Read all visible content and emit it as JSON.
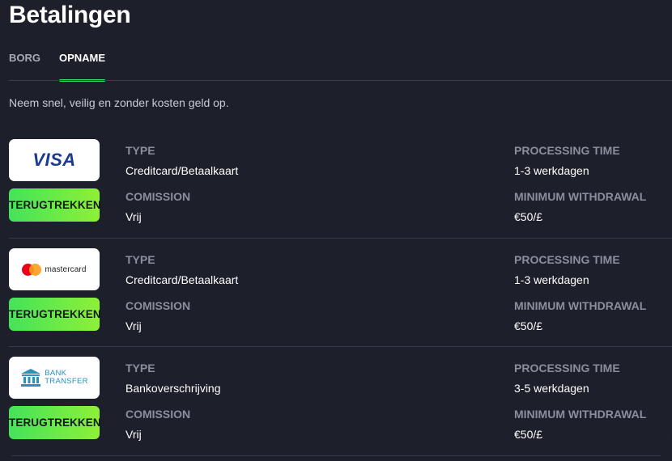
{
  "page": {
    "title": "Betalingen",
    "subtitle": "Neem snel, veilig en zonder kosten geld op."
  },
  "tabs": [
    {
      "label": "BORG",
      "active": false
    },
    {
      "label": "OPNAME",
      "active": true
    }
  ],
  "colors": {
    "background": "#1d1f2b",
    "accent": "#2ee36b",
    "button_start": "#43e35a",
    "button_end": "#8ef037",
    "label": "#8b8e9b"
  },
  "labels": {
    "type": "TYPE",
    "processing_time": "PROCESSING TIME",
    "commission": "COMISSION",
    "minimum_withdrawal": "MINIMUM WITHDRAWAL"
  },
  "methods": [
    {
      "logo": "visa-logo",
      "logo_text": "VISA",
      "button": "TERUGTREKKEN",
      "type": "Creditcard/Betaalkaart",
      "processing_time": "1-3 werkdagen",
      "commission": "Vrij",
      "minimum_withdrawal": "€50/£"
    },
    {
      "logo": "mastercard-logo",
      "logo_text": "mastercard",
      "button": "TERUGTREKKEN",
      "type": "Creditcard/Betaalkaart",
      "processing_time": "1-3 werkdagen",
      "commission": "Vrij",
      "minimum_withdrawal": "€50/£"
    },
    {
      "logo": "bank-transfer-logo",
      "logo_text_line1": "BANK",
      "logo_text_line2": "TRANSFER",
      "button": "TERUGTREKKEN",
      "type": "Bankoverschrijving",
      "processing_time": "3-5 werkdagen",
      "commission": "Vrij",
      "minimum_withdrawal": "€50/£"
    }
  ]
}
